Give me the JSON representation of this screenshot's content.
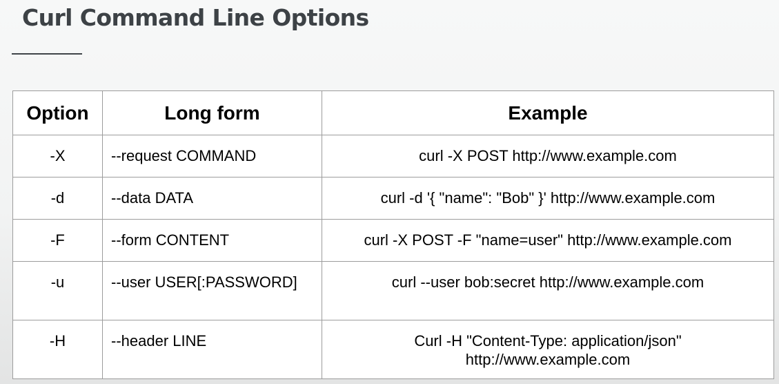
{
  "slide": {
    "title": "Curl Command Line Options"
  },
  "table": {
    "headers": {
      "option": "Option",
      "long_form": "Long form",
      "example": "Example"
    },
    "rows": [
      {
        "option": "-X",
        "long_form": "--request COMMAND",
        "example": "curl -X POST http://www.example.com"
      },
      {
        "option": "-d",
        "long_form": "--data DATA",
        "example": "curl -d '{ \"name\": \"Bob\" }' http://www.example.com"
      },
      {
        "option": "-F",
        "long_form": "--form CONTENT",
        "example": "curl -X POST -F \"name=user\" http://www.example.com"
      },
      {
        "option": "-u",
        "long_form": "--user USER[:PASSWORD]",
        "example": "curl --user bob:secret http://www.example.com"
      },
      {
        "option": "-H",
        "long_form": "--header LINE",
        "example": "Curl -H \"Content-Type: application/json\" http://www.example.com"
      }
    ]
  }
}
